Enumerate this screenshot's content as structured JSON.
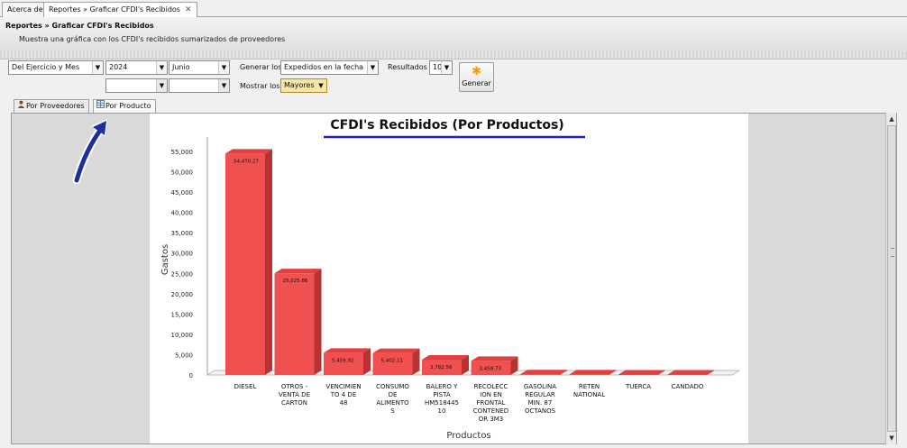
{
  "tabs": [
    {
      "label": "Acerca de"
    },
    {
      "label": "Reportes » Graficar CFDI's Recibidos",
      "close": "✕"
    }
  ],
  "header": {
    "title": "Reportes » Graficar CFDI's Recibidos",
    "description": "Muestra una gráfica con los CFDI's recibidos sumarizados de proveedores"
  },
  "controls": {
    "period": "Del Ejercicio y Mes",
    "year": "2024",
    "month": "Junio",
    "year_alt": "",
    "month_alt": "",
    "generar_los_label": "Generar los",
    "generar_los_value": "Expedidos en la fecha",
    "resultados_label": "Resultados",
    "resultados_value": "10",
    "mostrar_los_label": "Mostrar los",
    "mostrar_los_value": "Mayores",
    "generate_button": "Generar"
  },
  "inner_tabs": [
    {
      "label": "Por Proveedores",
      "icon": "user-icon"
    },
    {
      "label": "Por Producto",
      "icon": "table-icon"
    }
  ],
  "colors": {
    "bar": "#f05050",
    "bar_side": "#b83232",
    "title_underline": "#2020c0"
  },
  "chart_data": {
    "type": "bar",
    "title": "CFDI's Recibidos (Por Productos)",
    "xlabel": "Productos",
    "ylabel": "Gastos",
    "ylim": [
      0,
      55000
    ],
    "yticks": [
      "55,000",
      "50,000",
      "45,000",
      "40,000",
      "35,000",
      "30,000",
      "25,000",
      "20,000",
      "15,000",
      "10,000",
      "5,000",
      "0"
    ],
    "categories": [
      [
        "DIESEL"
      ],
      [
        "OTROS -",
        "VENTA DE",
        "CARTON"
      ],
      [
        "VENCIMIEN",
        "TO 4   DE",
        "48"
      ],
      [
        "CONSUMO",
        "DE",
        "ALIMENTO",
        "S"
      ],
      [
        "BALERO Y",
        "PISTA",
        "HM518445",
        "10"
      ],
      [
        "RECOLECC",
        "ION EN",
        "FRONTAL",
        "CONTENED",
        "OR 3M3"
      ],
      [
        "GASOLINA",
        "REGULAR",
        "MIN. 87",
        "OCTANOS"
      ],
      [
        "RETEN",
        "NATIONAL"
      ],
      [
        "TUERCA"
      ],
      [
        "CANDADO"
      ]
    ],
    "values": [
      54470.27,
      25025.86,
      5459.92,
      5402.11,
      3782.56,
      3459.73,
      180,
      150,
      120,
      100
    ],
    "data_labels": [
      "54,470.27",
      "25,025.86",
      "5,459.92",
      "5,402.11",
      "3,782.56",
      "3,459.73",
      "",
      "",
      "",
      ""
    ]
  }
}
